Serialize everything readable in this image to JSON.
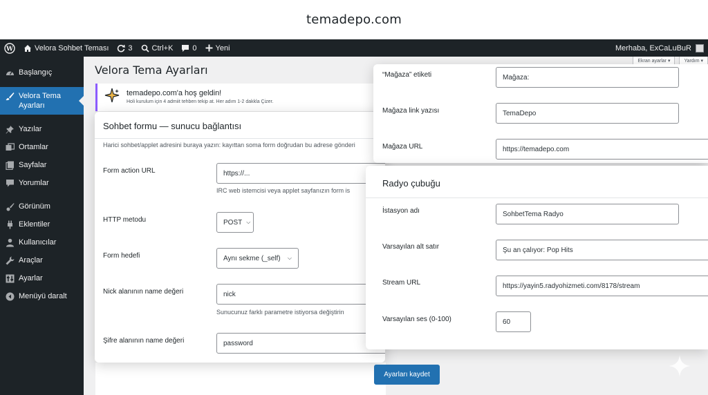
{
  "site_header": "temadepo.com",
  "adminbar": {
    "site_name": "Velora Sohbet Teması",
    "updates_count": "3",
    "search_label": "Ctrl+K",
    "comments_count": "0",
    "new_label": "Yeni",
    "greeting": "Merhaba, ExCaLuBuR"
  },
  "sidebar": {
    "items": [
      {
        "label": "Başlangıç",
        "icon": "dashboard-icon"
      },
      {
        "label": "Velora Tema Ayarları",
        "icon": "brush-icon"
      },
      {
        "label": "Yazılar",
        "icon": "pin-icon"
      },
      {
        "label": "Ortamlar",
        "icon": "media-icon"
      },
      {
        "label": "Sayfalar",
        "icon": "pages-icon"
      },
      {
        "label": "Yorumlar",
        "icon": "comments-icon"
      },
      {
        "label": "Görünüm",
        "icon": "appearance-icon"
      },
      {
        "label": "Eklentiler",
        "icon": "plugins-icon"
      },
      {
        "label": "Kullanıcılar",
        "icon": "users-icon"
      },
      {
        "label": "Araçlar",
        "icon": "tools-icon"
      },
      {
        "label": "Ayarlar",
        "icon": "settings-icon"
      },
      {
        "label": "Menüyü daralt",
        "icon": "collapse-icon"
      }
    ]
  },
  "page": {
    "title": "Velora Tema Ayarları",
    "screen_options": "Ekran ayarlar ▾",
    "help": "Yardım ▾"
  },
  "notice": {
    "title": "temadepo.com'a hoş geldin!",
    "subtitle": "Holi kurulum için 4 admiit tehben tekip at. Her adım 1-2 dakkla Çizer."
  },
  "form_card": {
    "title": "Sohbet formu — sunucu bağlantısı",
    "description": "Harici sohbet/applet adresini buraya yazın: kayıttan soma form doğrudan bu adrese gönderi",
    "action_label": "Form action URL",
    "action_value": "https://...",
    "action_hint": "IRC web istemcisi veya applet sayfanızın form is",
    "method_label": "HTTP metodu",
    "method_value": "POST",
    "target_label": "Form hedefi",
    "target_value": "Aynı sekme (_self)",
    "nick_label": "Nick alanının name değeri",
    "nick_value": "nick",
    "nick_hint": "Sunucunuz farklı parametre istiyorsa değiştirin",
    "pass_label": "Şifre alanının name değeri",
    "pass_value": "password"
  },
  "store_card": {
    "label_label": "“Mağaza” etiketi",
    "label_value": "Mağaza:",
    "link_label": "Mağaza link yazısı",
    "link_value": "TemaDepo",
    "url_label": "Mağaza URL",
    "url_value": "https://temadepo.com"
  },
  "radio_card": {
    "title": "Radyo çubuğu",
    "station_label": "İstasyon adı",
    "station_value": "SohbetTema Radyo",
    "subline_label": "Varsayılan alt satır",
    "subline_value": "Şu an çalıyor: Pop Hits",
    "stream_label": "Stream URL",
    "stream_value": "https://yayin5.radyohizmeti.com/8178/stream",
    "volume_label": "Varsayılan ses (0-100)",
    "volume_value": "60"
  },
  "save_button": "Ayarları kaydet",
  "colors": {
    "admin_dark": "#1d2327",
    "accent": "#2271b1",
    "notice_border": "#8c5cff"
  }
}
